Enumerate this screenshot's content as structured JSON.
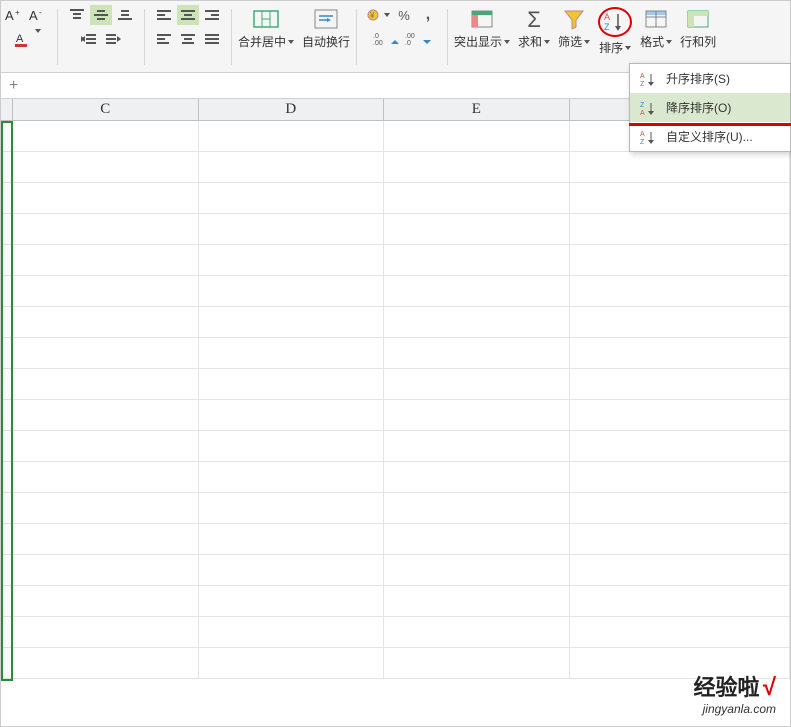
{
  "ribbon": {
    "merge_center": "合并居中",
    "wrap_text": "自动换行",
    "percent": "%",
    "comma": ",",
    "inc_dec1": ".0",
    "inc_dec2": ".00",
    "highlight": "突出显示",
    "sum": "求和",
    "sigma": "Σ",
    "filter": "筛选",
    "sort": "排序",
    "format": "格式",
    "row_col": "行和列"
  },
  "sort_menu": {
    "asc": "升序排序(S)",
    "desc": "降序排序(O)",
    "custom": "自定义排序(U)..."
  },
  "formula_bar": {
    "plus": "+"
  },
  "columns": [
    "C",
    "D",
    "E"
  ],
  "watermark": {
    "main": "经验啦",
    "check": "√",
    "sub": "jingyanla.com"
  },
  "colors": {
    "accent_green": "#2e8b3d",
    "red": "#d00"
  }
}
